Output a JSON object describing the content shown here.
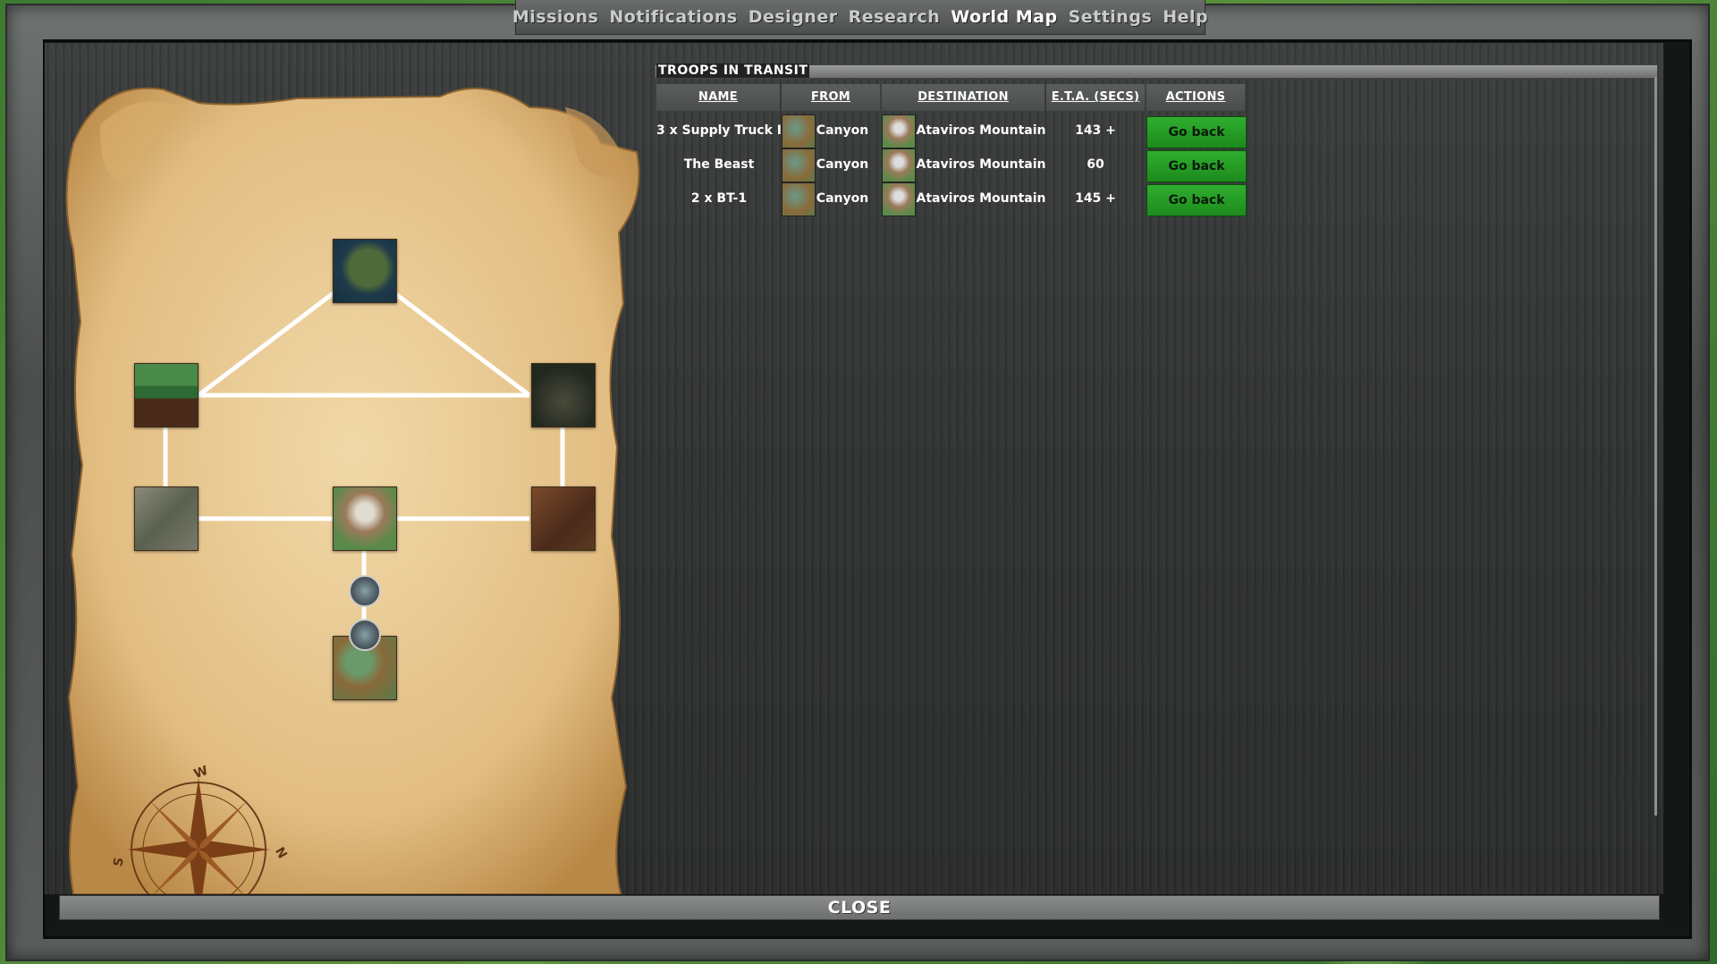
{
  "nav": {
    "tabs": [
      {
        "label": "Missions"
      },
      {
        "label": "Notifications"
      },
      {
        "label": "Designer"
      },
      {
        "label": "Research"
      },
      {
        "label": "World Map",
        "active": true
      },
      {
        "label": "Settings"
      },
      {
        "label": "Help"
      }
    ]
  },
  "transit": {
    "title": "TROOPS IN TRANSIT",
    "headers": {
      "name": "NAME",
      "from": "FROM",
      "destination": "DESTINATION",
      "eta": "E.T.A. (SECS)",
      "actions": "ACTIONS"
    },
    "rows": [
      {
        "name": "3 x Supply Truck I",
        "from": "Canyon",
        "destination": "Ataviros Mountain",
        "eta": "143 +",
        "action": "Go back"
      },
      {
        "name": "The Beast",
        "from": "Canyon",
        "destination": "Ataviros Mountain",
        "eta": "60",
        "action": "Go back"
      },
      {
        "name": "2 x BT-1",
        "from": "Canyon",
        "destination": "Ataviros Mountain",
        "eta": "145 +",
        "action": "Go back"
      }
    ]
  },
  "compass": {
    "west": "W",
    "south": "S",
    "north": "N"
  },
  "footer": {
    "close_label": "CLOSE"
  },
  "colors": {
    "go_back": "#22a022",
    "panel": "#2f3231",
    "parchment": "#e8c690"
  }
}
